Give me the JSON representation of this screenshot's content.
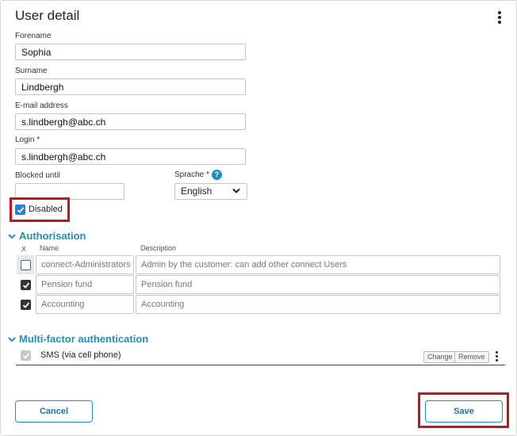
{
  "panel": {
    "title": "User detail"
  },
  "form": {
    "forename": {
      "label": "Forename",
      "value": "Sophia"
    },
    "surname": {
      "label": "Surname",
      "value": "Lindbergh"
    },
    "email": {
      "label": "E-mail address",
      "value": "s.lindbergh@abc.ch"
    },
    "login": {
      "label": "Login *",
      "value": "s.lindbergh@abc.ch"
    },
    "blocked_until": {
      "label": "Blocked until",
      "value": ""
    },
    "language": {
      "label": "Sprache *",
      "help": "?",
      "value": "English"
    },
    "disabled": {
      "label": "Disabled",
      "checked": true
    }
  },
  "authorisation": {
    "title": "Authorisation",
    "col_x": "X",
    "col_name": "Name",
    "col_description": "Description",
    "rows": [
      {
        "name": "connect-Administrators",
        "description": "Admin by the customer: can add other connect Users",
        "checked": false
      },
      {
        "name": "Pension fund",
        "description": "Pension fund",
        "checked": true
      },
      {
        "name": "Accounting",
        "description": "Accounting",
        "checked": true
      }
    ]
  },
  "mfa": {
    "title": "Multi-factor authentication",
    "method": "SMS (via cell phone)",
    "change_label": "Change",
    "remove_label": "Remove"
  },
  "footer": {
    "cancel_label": "Cancel",
    "save_label": "Save"
  },
  "colors": {
    "accent": "#1e8fbf",
    "highlight_red": "#c0161f",
    "checkbox_blue": "#2b7cd3"
  }
}
